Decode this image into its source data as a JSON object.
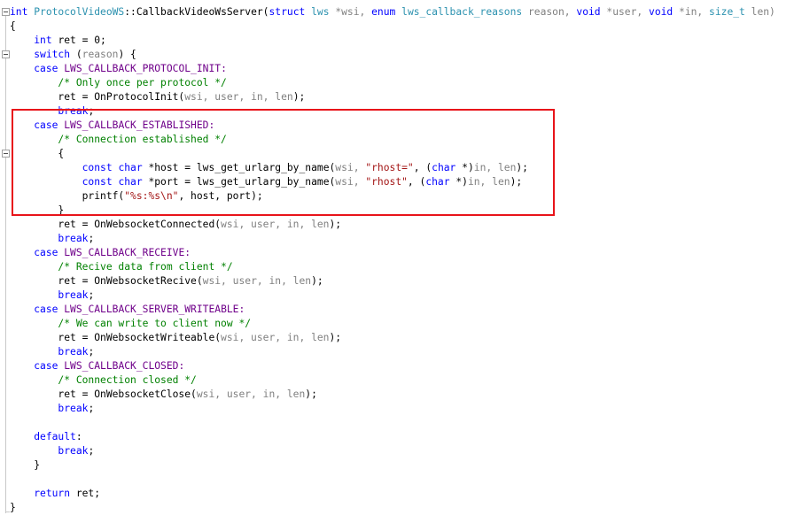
{
  "editor": {
    "highlight_color": "#e8141a",
    "lines": [
      [
        {
          "t": "int ",
          "c": "kw"
        },
        {
          "t": "ProtocolVideoWS",
          "c": "ty"
        },
        {
          "t": "::CallbackVideoWsServer(",
          "c": ""
        },
        {
          "t": "struct ",
          "c": "kw"
        },
        {
          "t": "lws ",
          "c": "ty"
        },
        {
          "t": "*wsi, ",
          "c": "pm"
        },
        {
          "t": "enum ",
          "c": "kw"
        },
        {
          "t": "lws_callback_reasons ",
          "c": "ty"
        },
        {
          "t": "reason, ",
          "c": "pm"
        },
        {
          "t": "void ",
          "c": "kw"
        },
        {
          "t": "*user, ",
          "c": "pm"
        },
        {
          "t": "void ",
          "c": "kw"
        },
        {
          "t": "*in, ",
          "c": "pm"
        },
        {
          "t": "size_t ",
          "c": "ty"
        },
        {
          "t": "len)",
          "c": "pm"
        }
      ],
      [
        {
          "t": "{",
          "c": ""
        }
      ],
      [
        {
          "t": "    ",
          "c": ""
        },
        {
          "t": "int ",
          "c": "kw"
        },
        {
          "t": "ret = 0;",
          "c": ""
        }
      ],
      [
        {
          "t": "    ",
          "c": ""
        },
        {
          "t": "switch ",
          "c": "kw"
        },
        {
          "t": "(",
          "c": ""
        },
        {
          "t": "reason",
          "c": "pm"
        },
        {
          "t": ") {",
          "c": ""
        }
      ],
      [
        {
          "t": "    ",
          "c": ""
        },
        {
          "t": "case ",
          "c": "kw"
        },
        {
          "t": "LWS_CALLBACK_PROTOCOL_INIT:",
          "c": "macro"
        }
      ],
      [
        {
          "t": "        ",
          "c": ""
        },
        {
          "t": "/* Only once per protocol */",
          "c": "cm"
        }
      ],
      [
        {
          "t": "        ret = OnProtocolInit(",
          "c": ""
        },
        {
          "t": "wsi, user, in, len",
          "c": "pm"
        },
        {
          "t": ");",
          "c": ""
        }
      ],
      [
        {
          "t": "        ",
          "c": ""
        },
        {
          "t": "break",
          "c": "kw"
        },
        {
          "t": ";",
          "c": ""
        }
      ],
      [
        {
          "t": "    ",
          "c": ""
        },
        {
          "t": "case ",
          "c": "kw"
        },
        {
          "t": "LWS_CALLBACK_ESTABLISHED:",
          "c": "macro"
        }
      ],
      [
        {
          "t": "        ",
          "c": ""
        },
        {
          "t": "/* Connection established */",
          "c": "cm"
        }
      ],
      [
        {
          "t": "        {",
          "c": ""
        }
      ],
      [
        {
          "t": "            ",
          "c": ""
        },
        {
          "t": "const ",
          "c": "kw"
        },
        {
          "t": "char ",
          "c": "kw"
        },
        {
          "t": "*host = lws_get_urlarg_by_name(",
          "c": ""
        },
        {
          "t": "wsi, ",
          "c": "pm"
        },
        {
          "t": "\"rhost=\"",
          "c": "st"
        },
        {
          "t": ", (",
          "c": ""
        },
        {
          "t": "char ",
          "c": "kw"
        },
        {
          "t": "*)",
          "c": ""
        },
        {
          "t": "in, len",
          "c": "pm"
        },
        {
          "t": ");",
          "c": ""
        }
      ],
      [
        {
          "t": "            ",
          "c": ""
        },
        {
          "t": "const ",
          "c": "kw"
        },
        {
          "t": "char ",
          "c": "kw"
        },
        {
          "t": "*port = lws_get_urlarg_by_name(",
          "c": ""
        },
        {
          "t": "wsi, ",
          "c": "pm"
        },
        {
          "t": "\"rhost\"",
          "c": "st"
        },
        {
          "t": ", (",
          "c": ""
        },
        {
          "t": "char ",
          "c": "kw"
        },
        {
          "t": "*)",
          "c": ""
        },
        {
          "t": "in, len",
          "c": "pm"
        },
        {
          "t": ");",
          "c": ""
        }
      ],
      [
        {
          "t": "            printf(",
          "c": ""
        },
        {
          "t": "\"%s:%s\\n\"",
          "c": "st"
        },
        {
          "t": ", host, port);",
          "c": ""
        }
      ],
      [
        {
          "t": "        }",
          "c": ""
        }
      ],
      [
        {
          "t": "        ret = OnWebsocketConnected(",
          "c": ""
        },
        {
          "t": "wsi, user, in, len",
          "c": "pm"
        },
        {
          "t": ");",
          "c": ""
        }
      ],
      [
        {
          "t": "        ",
          "c": ""
        },
        {
          "t": "break",
          "c": "kw"
        },
        {
          "t": ";",
          "c": ""
        }
      ],
      [
        {
          "t": "    ",
          "c": ""
        },
        {
          "t": "case ",
          "c": "kw"
        },
        {
          "t": "LWS_CALLBACK_RECEIVE:",
          "c": "macro"
        }
      ],
      [
        {
          "t": "        ",
          "c": ""
        },
        {
          "t": "/* Recive data from client */",
          "c": "cm"
        }
      ],
      [
        {
          "t": "        ret = OnWebsocketRecive(",
          "c": ""
        },
        {
          "t": "wsi, user, in, len",
          "c": "pm"
        },
        {
          "t": ");",
          "c": ""
        }
      ],
      [
        {
          "t": "        ",
          "c": ""
        },
        {
          "t": "break",
          "c": "kw"
        },
        {
          "t": ";",
          "c": ""
        }
      ],
      [
        {
          "t": "    ",
          "c": ""
        },
        {
          "t": "case ",
          "c": "kw"
        },
        {
          "t": "LWS_CALLBACK_SERVER_WRITEABLE:",
          "c": "macro"
        }
      ],
      [
        {
          "t": "        ",
          "c": ""
        },
        {
          "t": "/* We can write to client now */",
          "c": "cm"
        }
      ],
      [
        {
          "t": "        ret = OnWebsocketWriteable(",
          "c": ""
        },
        {
          "t": "wsi, user, in, len",
          "c": "pm"
        },
        {
          "t": ");",
          "c": ""
        }
      ],
      [
        {
          "t": "        ",
          "c": ""
        },
        {
          "t": "break",
          "c": "kw"
        },
        {
          "t": ";",
          "c": ""
        }
      ],
      [
        {
          "t": "    ",
          "c": ""
        },
        {
          "t": "case ",
          "c": "kw"
        },
        {
          "t": "LWS_CALLBACK_CLOSED:",
          "c": "macro"
        }
      ],
      [
        {
          "t": "        ",
          "c": ""
        },
        {
          "t": "/* Connection closed */",
          "c": "cm"
        }
      ],
      [
        {
          "t": "        ret = OnWebsocketClose(",
          "c": ""
        },
        {
          "t": "wsi, user, in, len",
          "c": "pm"
        },
        {
          "t": ");",
          "c": ""
        }
      ],
      [
        {
          "t": "        ",
          "c": ""
        },
        {
          "t": "break",
          "c": "kw"
        },
        {
          "t": ";",
          "c": ""
        }
      ],
      [
        {
          "t": "",
          "c": ""
        }
      ],
      [
        {
          "t": "    ",
          "c": ""
        },
        {
          "t": "default",
          "c": "kw"
        },
        {
          "t": ":",
          "c": ""
        }
      ],
      [
        {
          "t": "        ",
          "c": ""
        },
        {
          "t": "break",
          "c": "kw"
        },
        {
          "t": ";",
          "c": ""
        }
      ],
      [
        {
          "t": "    }",
          "c": ""
        }
      ],
      [
        {
          "t": "",
          "c": ""
        }
      ],
      [
        {
          "t": "    ",
          "c": ""
        },
        {
          "t": "return ",
          "c": "kw"
        },
        {
          "t": "ret;",
          "c": ""
        }
      ],
      [
        {
          "t": "}",
          "c": ""
        }
      ]
    ]
  }
}
